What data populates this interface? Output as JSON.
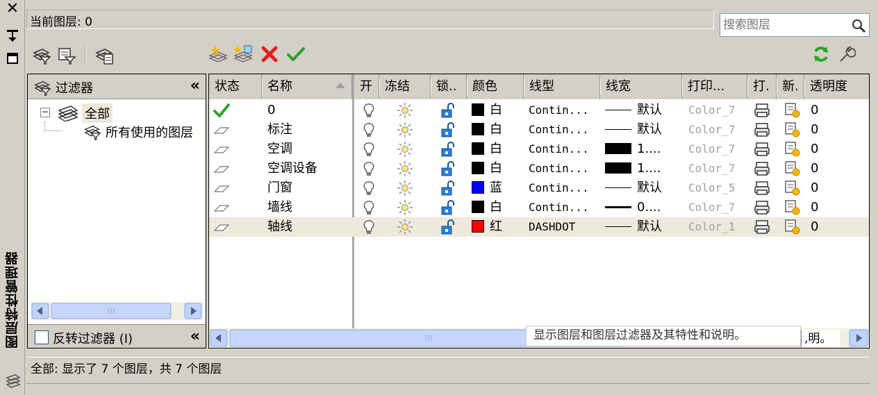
{
  "palette": {
    "title": "图层特性管理器",
    "close": "✕"
  },
  "current_layer": {
    "label": "当前图层: 0"
  },
  "search": {
    "placeholder": "搜索图层"
  },
  "filter_tree": {
    "header": "过滤器",
    "collapse": "«",
    "root": "全部",
    "child": "所有使用的图层",
    "invert_label": "反转过滤器 (I)"
  },
  "columns": {
    "status": "状态",
    "name": "名称",
    "on": "开",
    "freeze": "冻结",
    "lock": "锁..",
    "color": "颜色",
    "linetype": "线型",
    "lineweight": "线宽",
    "plotstyle": "打印...",
    "plot": "打.",
    "newvp": "新.",
    "transparency": "透明度"
  },
  "layers": [
    {
      "name": "0",
      "current": true,
      "color_name": "白",
      "color_hex": "#000000",
      "linetype": "Contin...",
      "lw_style": "thin",
      "lineweight": "默认",
      "plotstyle": "Color_7",
      "transparency": "0"
    },
    {
      "name": "标注",
      "current": false,
      "color_name": "白",
      "color_hex": "#000000",
      "linetype": "Contin...",
      "lw_style": "thin",
      "lineweight": "默认",
      "plotstyle": "Color_7",
      "transparency": "0"
    },
    {
      "name": "空调",
      "current": false,
      "color_name": "白",
      "color_hex": "#000000",
      "linetype": "Contin...",
      "lw_style": "thick",
      "lineweight": "1....",
      "plotstyle": "Color_7",
      "transparency": "0"
    },
    {
      "name": "空调设备",
      "current": false,
      "color_name": "白",
      "color_hex": "#000000",
      "linetype": "Contin...",
      "lw_style": "thick",
      "lineweight": "1....",
      "plotstyle": "Color_7",
      "transparency": "0"
    },
    {
      "name": "门窗",
      "current": false,
      "color_name": "蓝",
      "color_hex": "#0000ff",
      "linetype": "Contin...",
      "lw_style": "thin",
      "lineweight": "默认",
      "plotstyle": "Color_5",
      "transparency": "0"
    },
    {
      "name": "墙线",
      "current": false,
      "color_name": "白",
      "color_hex": "#000000",
      "linetype": "Contin...",
      "lw_style": "med",
      "lineweight": "0....",
      "plotstyle": "Color_7",
      "transparency": "0"
    },
    {
      "name": "轴线",
      "current": false,
      "selected": true,
      "color_name": "红",
      "color_hex": "#ff0000",
      "linetype": "DASHDOT",
      "lw_style": "thin",
      "lineweight": "默认",
      "plotstyle": "Color_1",
      "transparency": "0"
    }
  ],
  "tooltip": {
    "text": "显示图层和图层过滤器及其特性和说明。",
    "tail": ",明。"
  },
  "status": {
    "text": "全部: 显示了 7 个图层，共 7 个图层"
  },
  "icons": {
    "toolbar": [
      "new-property-filter-icon",
      "new-group-filter-icon",
      "layer-states-manager-icon",
      "new-layer-icon",
      "new-layer-vp-frozen-icon",
      "delete-layer-icon",
      "set-current-icon",
      "refresh-icon",
      "settings-icon"
    ]
  }
}
